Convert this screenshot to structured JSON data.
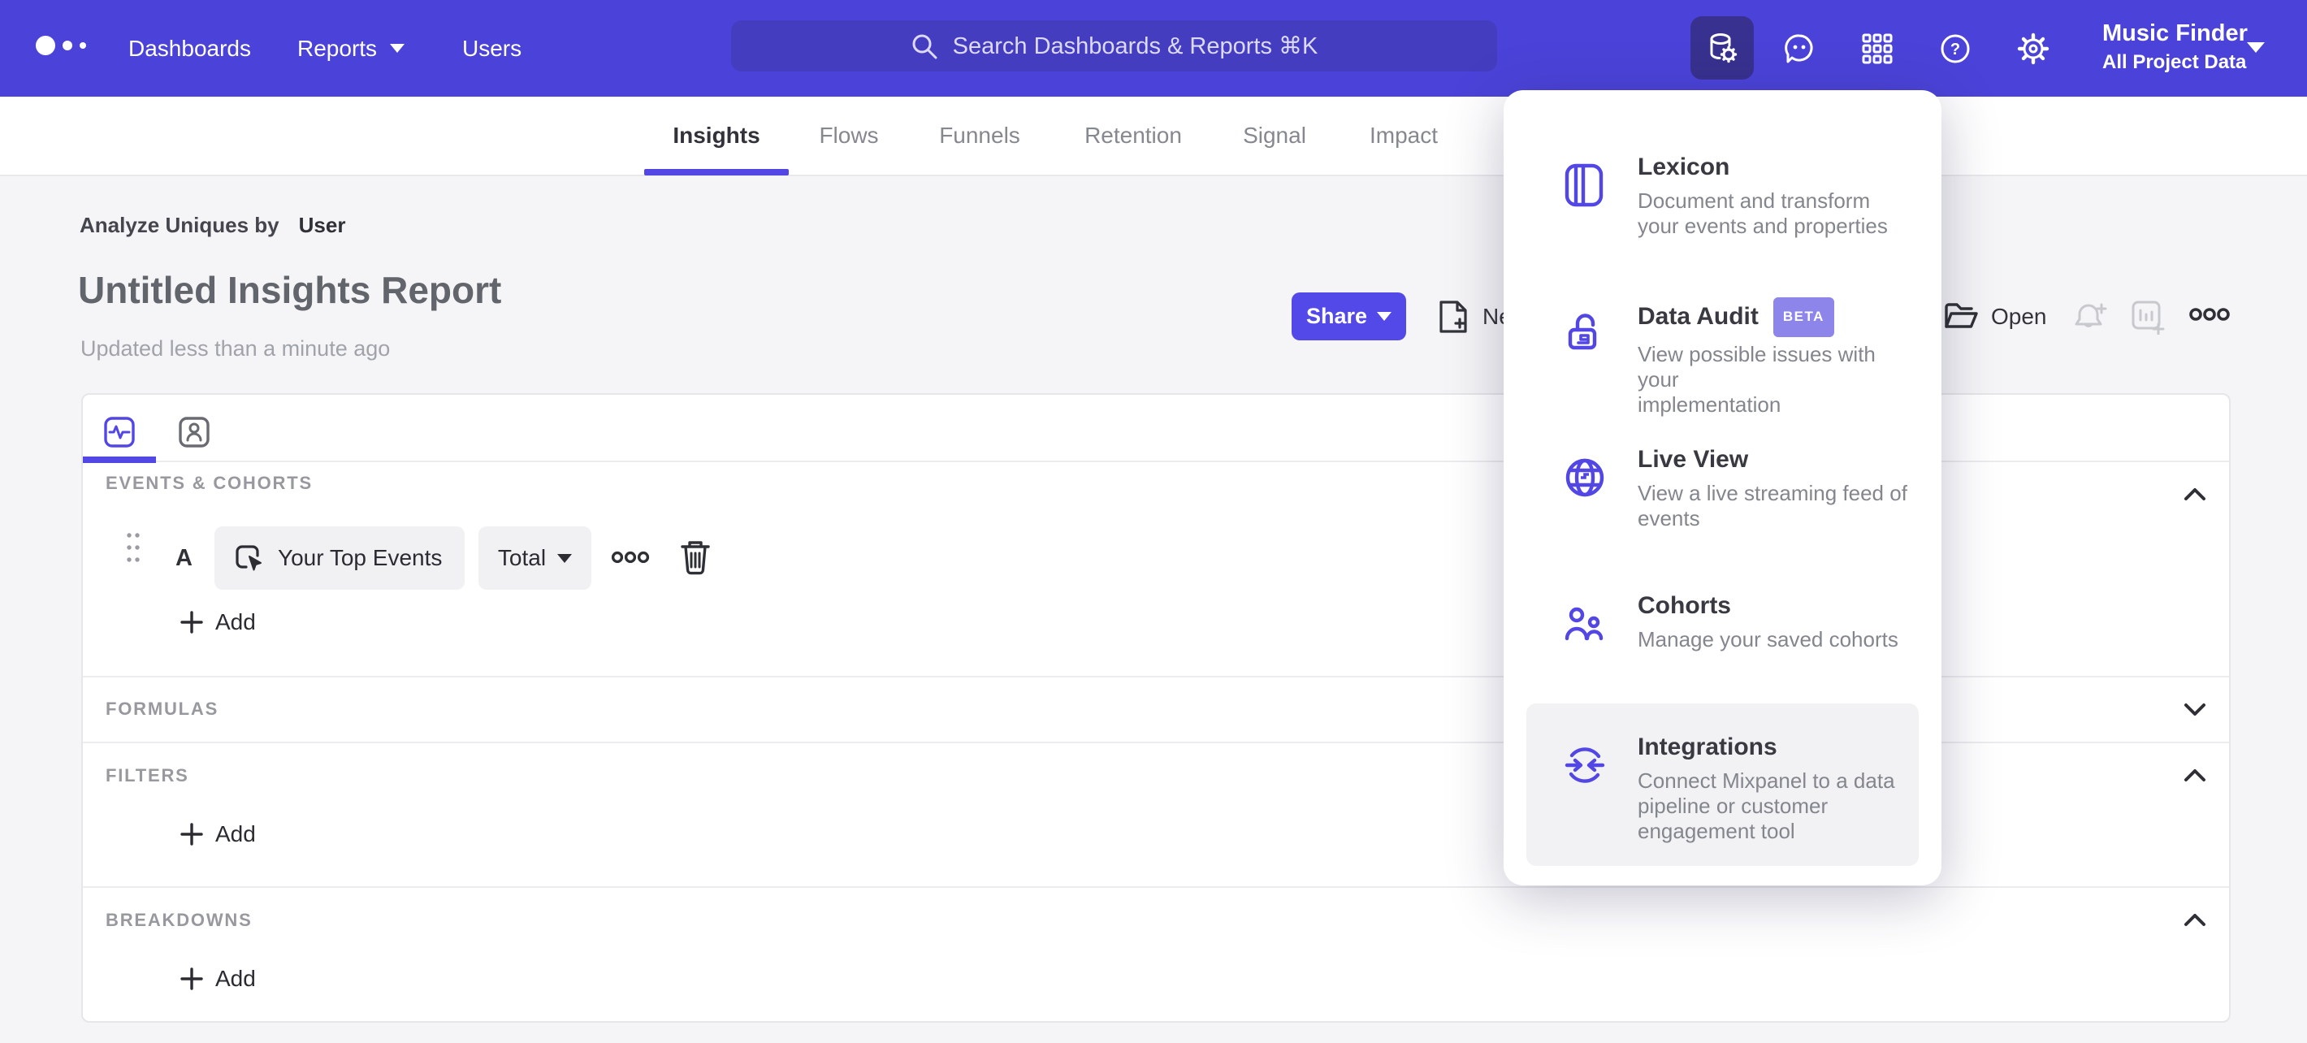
{
  "nav": {
    "items": [
      "Dashboards",
      "Reports",
      "Users"
    ],
    "search_placeholder": "Search Dashboards & Reports ⌘K",
    "project_name": "Music Finder",
    "project_scope": "All Project Data"
  },
  "tabs": {
    "items": [
      "Insights",
      "Flows",
      "Funnels",
      "Retention",
      "Signal",
      "Impact"
    ],
    "active": "Insights"
  },
  "report": {
    "analyze_label": "Analyze Uniques by",
    "analyze_value": "User",
    "title": "Untitled Insights Report",
    "updated": "Updated less than a minute ago"
  },
  "toolbar": {
    "share": "Share",
    "new": "New",
    "open": "Open"
  },
  "builder": {
    "events_header": "EVENTS & COHORTS",
    "row_letter": "A",
    "row_event": "Your Top Events",
    "row_metric": "Total",
    "add_label": "Add",
    "formulas_header": "FORMULAS",
    "filters_header": "FILTERS",
    "breakdowns_header": "BREAKDOWNS"
  },
  "menu": {
    "items": [
      {
        "title": "Lexicon",
        "desc": "Document and transform\nyour events and properties"
      },
      {
        "title": "Data Audit",
        "badge": "BETA",
        "desc": "View possible issues with your\nimplementation"
      },
      {
        "title": "Live View",
        "desc": "View a live streaming feed of\nevents"
      },
      {
        "title": "Cohorts",
        "desc": "Manage your saved cohorts"
      },
      {
        "title": "Integrations",
        "desc": "Connect Mixpanel to a data\npipeline or customer\nengagement tool"
      }
    ]
  },
  "colors": {
    "accent": "#5247e5",
    "nav_bg": "#4b43d9",
    "beta_bg": "#8d85ea"
  }
}
